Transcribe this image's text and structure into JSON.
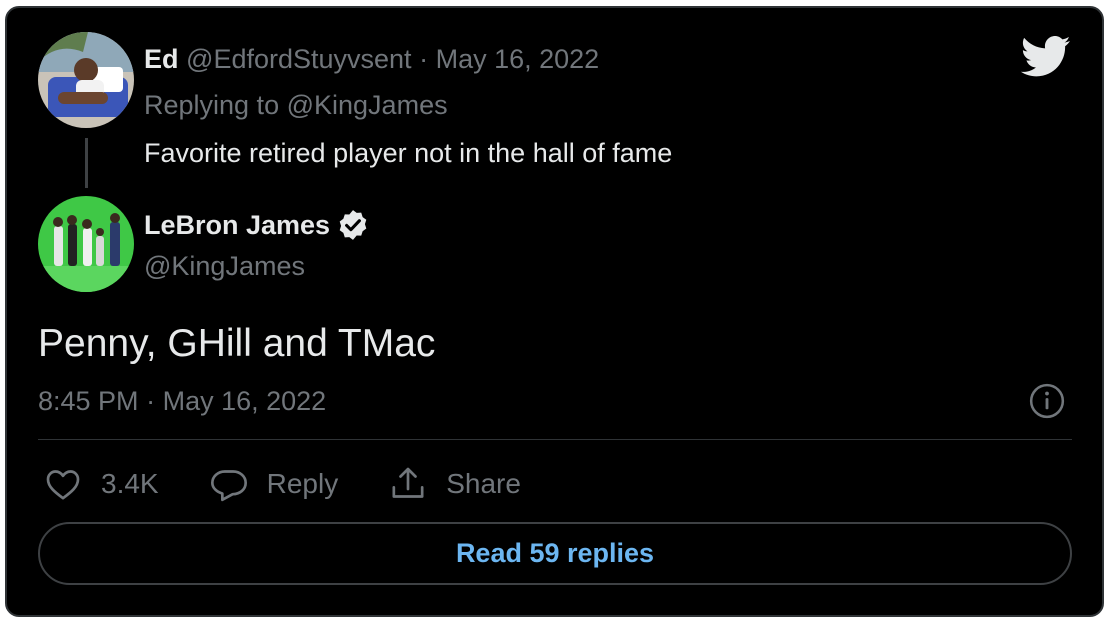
{
  "reply": {
    "author_name": "Ed",
    "author_handle": "@EdfordStuyvsent",
    "separator": "·",
    "date": "May 16, 2022",
    "replying_prefix": "Replying to",
    "replying_to": "@KingJames",
    "text": "Favorite retired player not in the hall of fame"
  },
  "tweet": {
    "author_name": "LeBron James",
    "author_handle": "@KingJames",
    "verified": true,
    "text": "Penny, GHill and TMac",
    "time": "8:45 PM",
    "separator": "·",
    "date": "May 16, 2022"
  },
  "actions": {
    "like_count": "3.4K",
    "reply_label": "Reply",
    "share_label": "Share"
  },
  "read_replies_label": "Read 59 replies",
  "icons": {
    "brand": "twitter-bird-icon",
    "verified": "verified-badge-icon",
    "info": "info-icon",
    "like": "heart-icon",
    "reply": "speech-bubble-icon",
    "share": "share-upload-icon"
  },
  "colors": {
    "background": "#000000",
    "text": "#e7e9ea",
    "muted": "#71767b",
    "link": "#6cb6f1",
    "border": "#2f3336"
  }
}
